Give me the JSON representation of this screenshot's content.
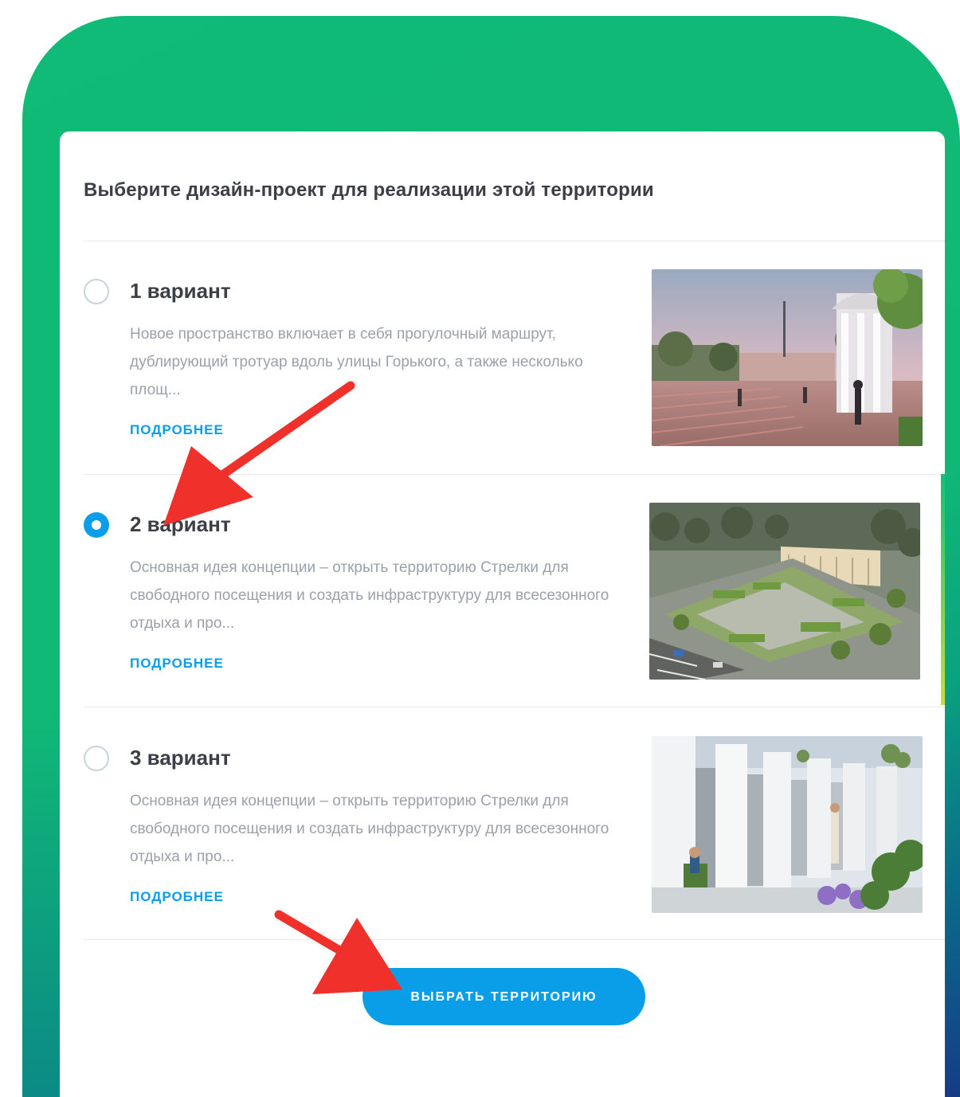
{
  "card": {
    "title": "Выберите дизайн-проект для реализации этой территории"
  },
  "options": [
    {
      "title": "1 вариант",
      "description": "Новое пространство включает в себя прогулочный маршрут, дублирующий тротуар вдоль улицы Горького, а также несколько площ...",
      "more_label": "ПОДРОБНЕЕ",
      "selected": false
    },
    {
      "title": "2 вариант",
      "description": "Основная идея концепции – открыть территорию Стрелки для свободного посещения и создать инфраструктуру для всесезонного отдыха и про...",
      "more_label": "ПОДРОБНЕЕ",
      "selected": true
    },
    {
      "title": "3 вариант",
      "description": "Основная идея концепции – открыть территорию Стрелки для свободного посещения и создать инфраструктуру для всесезонного отдыха и про...",
      "more_label": "ПОДРОБНЕЕ",
      "selected": false
    }
  ],
  "cta": {
    "label": "ВЫБРАТЬ ТЕРРИТОРИЮ"
  },
  "colors": {
    "accent": "#0a9ee8",
    "frame": "#10b876",
    "annotation_arrow": "#f0302a"
  }
}
